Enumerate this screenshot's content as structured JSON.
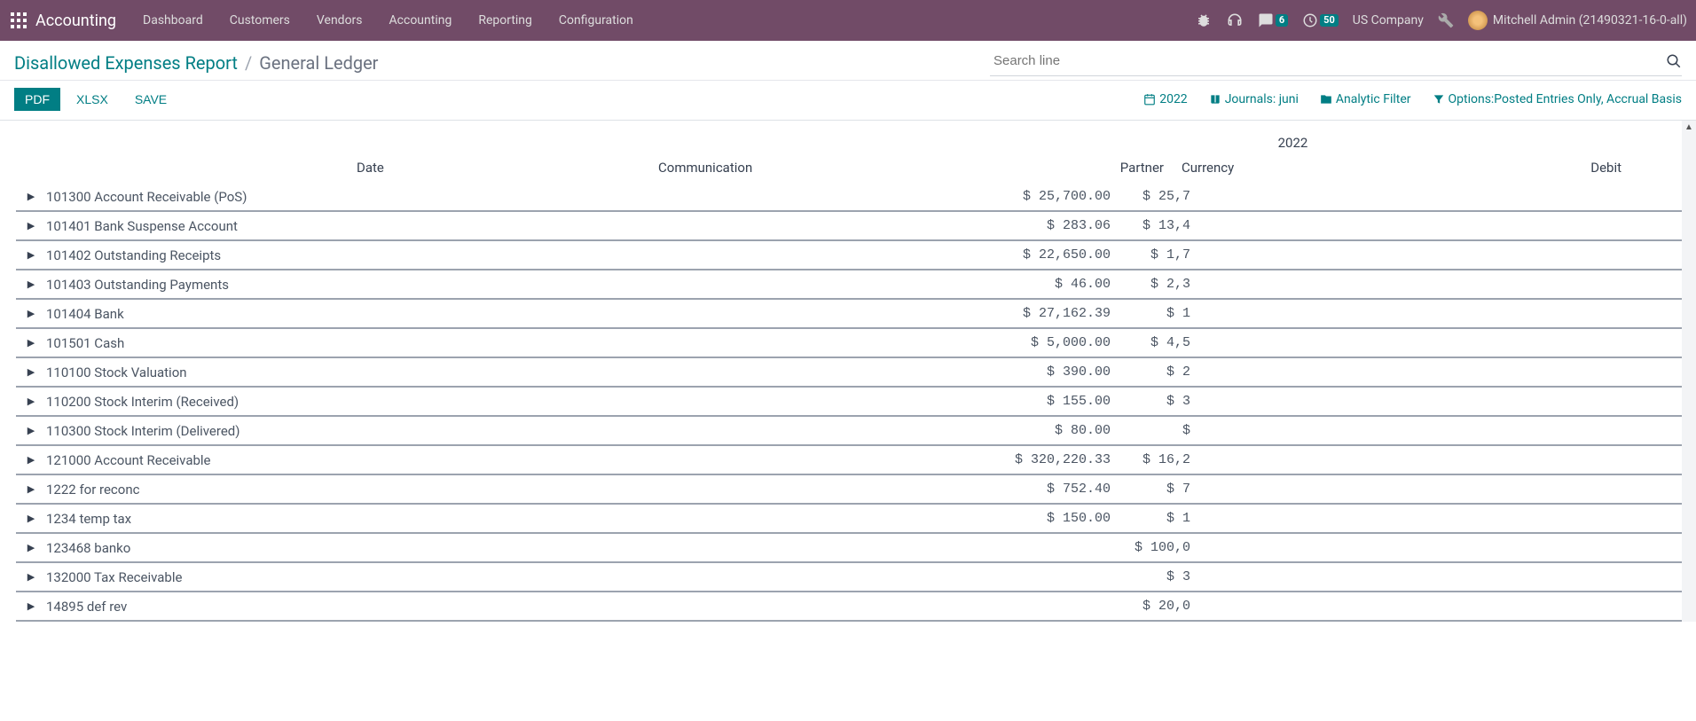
{
  "topbar": {
    "app_name": "Accounting",
    "menu": [
      "Dashboard",
      "Customers",
      "Vendors",
      "Accounting",
      "Reporting",
      "Configuration"
    ],
    "msg_badge": "6",
    "timer_badge": "50",
    "company": "US Company",
    "user": "Mitchell Admin (21490321-16-0-all)"
  },
  "breadcrumb": {
    "first": "Disallowed Expenses Report",
    "sep": "/",
    "second": "General Ledger"
  },
  "search": {
    "placeholder": "Search line"
  },
  "buttons": {
    "pdf": "PDF",
    "xlsx": "XLSX",
    "save": "SAVE"
  },
  "filters": {
    "year": "2022",
    "journals": " Journals: juni",
    "analytic": " Analytic Filter",
    "options": " Options:Posted Entries Only, Accrual Basis"
  },
  "columns": {
    "year": "2022",
    "date": "Date",
    "comm": "Communication",
    "partner": "Partner",
    "currency": "Currency",
    "debit": "Debit"
  },
  "rows": [
    {
      "name": "101300 Account Receivable (PoS)",
      "debit": "$ 25,700.00",
      "credit": "$ 25,7"
    },
    {
      "name": "101401 Bank Suspense Account",
      "debit": "$ 283.06",
      "credit": "$ 13,4"
    },
    {
      "name": "101402 Outstanding Receipts",
      "debit": "$ 22,650.00",
      "credit": "$ 1,7"
    },
    {
      "name": "101403 Outstanding Payments",
      "debit": "$ 46.00",
      "credit": "$ 2,3"
    },
    {
      "name": "101404 Bank",
      "debit": "$ 27,162.39",
      "credit": "$ 1"
    },
    {
      "name": "101501 Cash",
      "debit": "$ 5,000.00",
      "credit": "$ 4,5"
    },
    {
      "name": "110100 Stock Valuation",
      "debit": "$ 390.00",
      "credit": "$ 2"
    },
    {
      "name": "110200 Stock Interim (Received)",
      "debit": "$ 155.00",
      "credit": "$ 3"
    },
    {
      "name": "110300 Stock Interim (Delivered)",
      "debit": "$ 80.00",
      "credit": "$"
    },
    {
      "name": "121000 Account Receivable",
      "debit": "$ 320,220.33",
      "credit": "$ 16,2"
    },
    {
      "name": "1222 for reconc",
      "debit": "$ 752.40",
      "credit": "$ 7"
    },
    {
      "name": "1234 temp tax",
      "debit": "$ 150.00",
      "credit": "$ 1"
    },
    {
      "name": "123468 banko",
      "debit": "",
      "credit": "$ 100,0"
    },
    {
      "name": "132000 Tax Receivable",
      "debit": "",
      "credit": "$ 3"
    },
    {
      "name": "14895 def rev",
      "debit": "",
      "credit": "$ 20,0"
    }
  ]
}
